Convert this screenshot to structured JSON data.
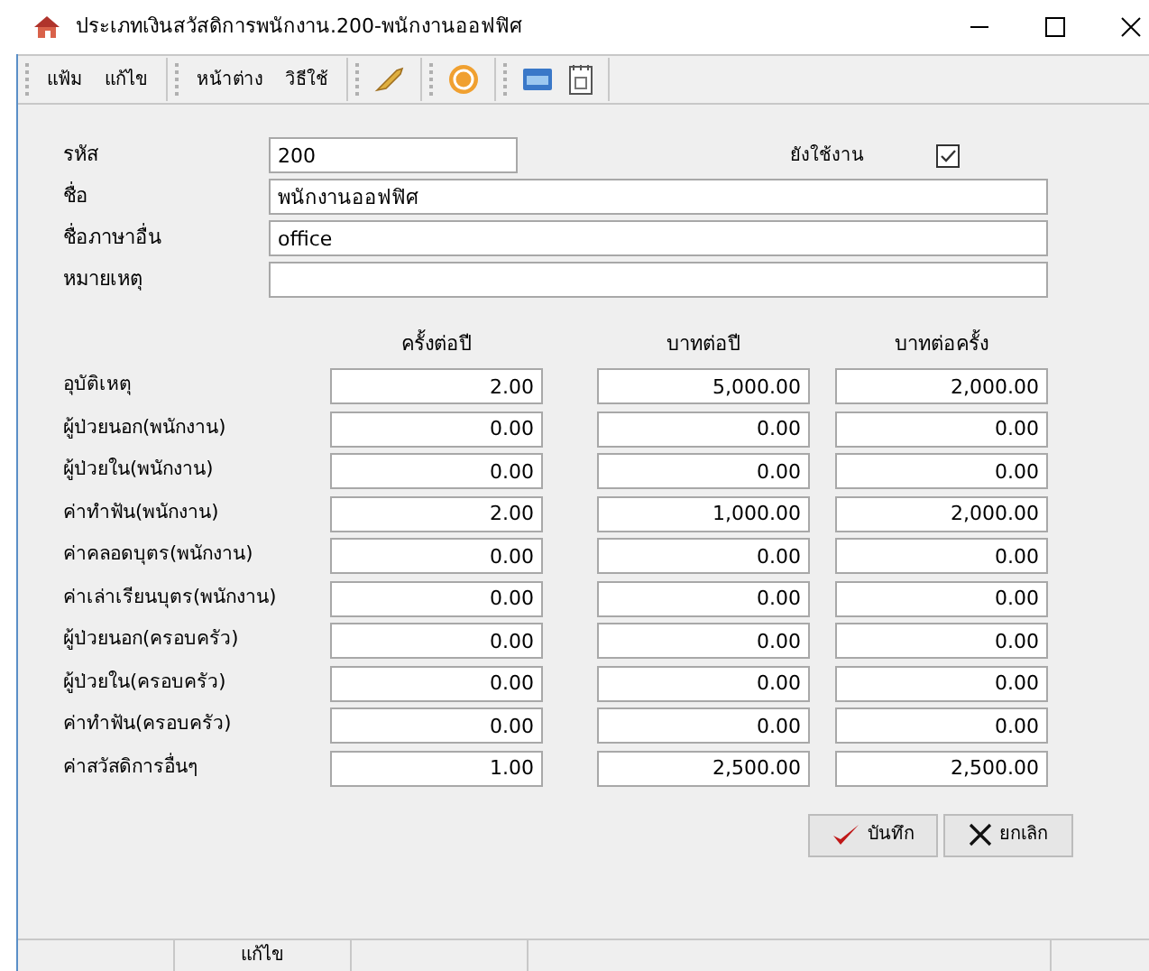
{
  "window": {
    "title": "ประเภทเงินสวัสดิการพนักงาน.200-พนักงานออฟฟิศ"
  },
  "menu": [
    {
      "label": "แฟ้ม"
    },
    {
      "label": "แก้ไข"
    },
    {
      "label": "หน้าต่าง"
    },
    {
      "label": "วิธีใช้"
    }
  ],
  "form": {
    "code": {
      "label": "รหัส",
      "value": "200"
    },
    "active": {
      "label": "ยังใช้งาน",
      "checked": true
    },
    "name": {
      "label": "ชื่อ",
      "value": "พนักงานออฟฟิศ"
    },
    "other_name": {
      "label": "ชื่อภาษาอื่น",
      "value": "office"
    },
    "note": {
      "label": "หมายเหตุ"
    }
  },
  "table": {
    "columns": [
      "ครั้งต่อปี",
      "บาทต่อปี",
      "บาทต่อครั้ง"
    ],
    "rows": [
      {
        "label": "อุบัติเหตุ",
        "values": [
          "2.00",
          "5,000.00",
          "2,000.00"
        ]
      },
      {
        "label": "ผู้ป่วยนอก(พนักงาน)",
        "values": [
          "0.00",
          "0.00",
          "0.00"
        ]
      },
      {
        "label": "ผู้ป่วยใน(พนักงาน)",
        "values": [
          "0.00",
          "0.00",
          "0.00"
        ]
      },
      {
        "label": "ค่าทำฟัน(พนักงาน)",
        "values": [
          "2.00",
          "1,000.00",
          "2,000.00"
        ]
      },
      {
        "label": "ค่าคลอดบุตร(พนักงาน)",
        "values": [
          "0.00",
          "0.00",
          "0.00"
        ]
      },
      {
        "label": "ค่าเล่าเรียนบุตร(พนักงาน)",
        "values": [
          "0.00",
          "0.00",
          "0.00"
        ]
      },
      {
        "label": "ผู้ป่วยนอก(ครอบครัว)",
        "values": [
          "0.00",
          "0.00",
          "0.00"
        ]
      },
      {
        "label": "ผู้ป่วยใน(ครอบครัว)",
        "values": [
          "0.00",
          "0.00",
          "0.00"
        ]
      },
      {
        "label": "ค่าทำฟัน(ครอบครัว)",
        "values": [
          "0.00",
          "0.00",
          "0.00"
        ]
      },
      {
        "label": "ค่าสวัสดิการอื่นๆ",
        "values": [
          "1.00",
          "2,500.00",
          "2,500.00"
        ]
      }
    ]
  },
  "buttons": [
    {
      "kind": "save",
      "label": "บันทึก"
    },
    {
      "kind": "cancel",
      "label": "ยกเลิก"
    }
  ],
  "status_bar": {
    "mode": "แก้ไข"
  }
}
